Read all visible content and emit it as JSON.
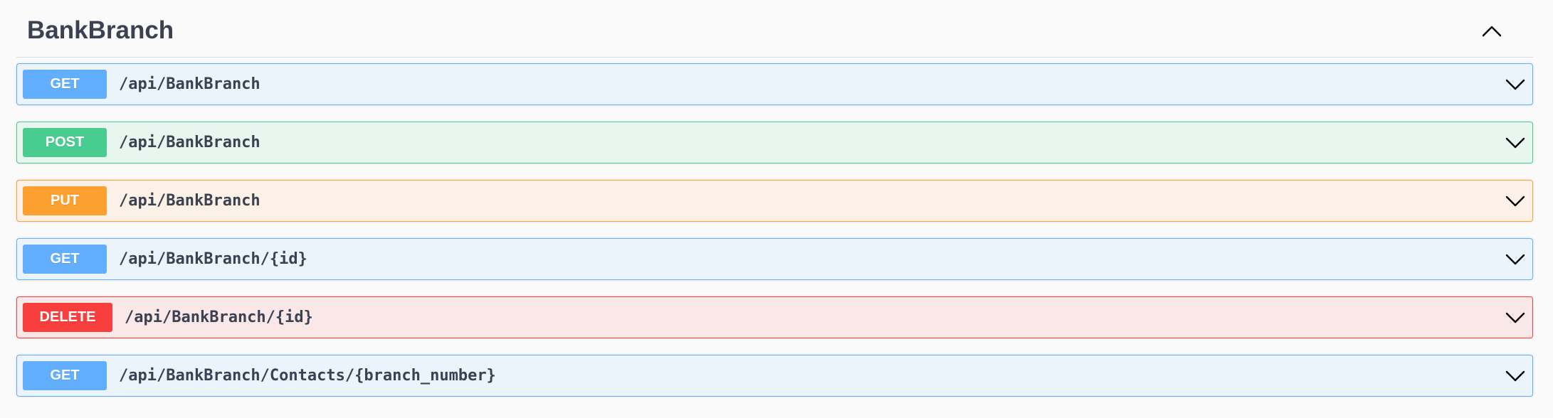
{
  "section": {
    "title": "BankBranch",
    "collapse_icon": "chevron-up-icon"
  },
  "operations": [
    {
      "method": "GET",
      "path": "/api/BankBranch",
      "expand_icon": "chevron-down-icon"
    },
    {
      "method": "POST",
      "path": "/api/BankBranch",
      "expand_icon": "chevron-down-icon"
    },
    {
      "method": "PUT",
      "path": "/api/BankBranch",
      "expand_icon": "chevron-down-icon"
    },
    {
      "method": "GET",
      "path": "/api/BankBranch/{id}",
      "expand_icon": "chevron-down-icon"
    },
    {
      "method": "DELETE",
      "path": "/api/BankBranch/{id}",
      "expand_icon": "chevron-down-icon"
    },
    {
      "method": "GET",
      "path": "/api/BankBranch/Contacts/{branch_number}",
      "expand_icon": "chevron-down-icon"
    }
  ],
  "colors": {
    "GET": "#61affe",
    "POST": "#49cc90",
    "PUT": "#fca130",
    "DELETE": "#f93e3e",
    "text": "#3b4151"
  }
}
